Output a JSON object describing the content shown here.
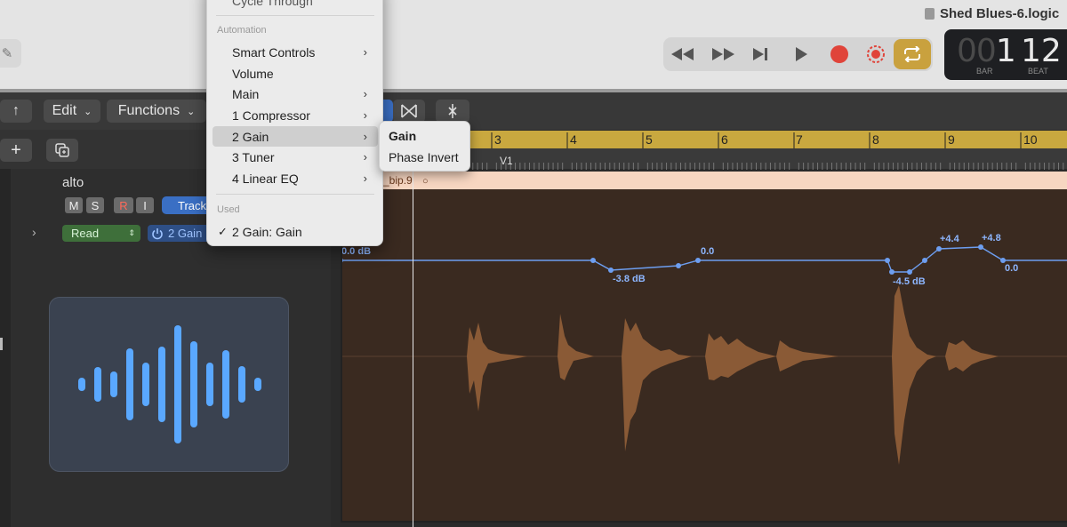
{
  "window": {
    "document_title": "Shed Blues-6.logic"
  },
  "lcd": {
    "bar_dim": "00",
    "bar_value": "1",
    "beat_value": "12",
    "bar_label": "BAR",
    "beat_label": "BEAT"
  },
  "toolbar": {
    "edit_label": "Edit",
    "functions_label": "Functions"
  },
  "ruler": {
    "bars": [
      "3",
      "4",
      "5",
      "6",
      "7",
      "8",
      "9",
      "10"
    ],
    "marker": "V1"
  },
  "track": {
    "name": "alto",
    "mute": "M",
    "solo": "S",
    "record": "R",
    "input": "I",
    "track_button": "Track",
    "automation_mode": "Read",
    "automation_param": "2 Gain"
  },
  "region": {
    "name": "_bip.9"
  },
  "automation_labels": [
    "0.0 dB",
    "-3.8 dB",
    "0.0",
    "-4.5 dB",
    "+4.4",
    "+4.8",
    "0.0"
  ],
  "menu": {
    "cut_off_item": "Cycle Through",
    "automation_header": "Automation",
    "items": [
      {
        "label": "Smart Controls",
        "submenu": true
      },
      {
        "label": "Volume",
        "submenu": false
      },
      {
        "label": "Main",
        "submenu": true
      },
      {
        "label": "1 Compressor",
        "submenu": true
      },
      {
        "label": "2 Gain",
        "submenu": true
      },
      {
        "label": "3 Tuner",
        "submenu": true
      },
      {
        "label": "4 Linear EQ",
        "submenu": true
      }
    ],
    "used_header": "Used",
    "used_items": [
      {
        "label": "2 Gain: Gain",
        "checked": true
      }
    ]
  },
  "submenu": {
    "items": [
      "Gain",
      "Phase Invert"
    ]
  },
  "colors": {
    "accent_cycle": "#c9a13e",
    "record_red": "#e0443a",
    "automation_line": "#6d9ef0",
    "waveform": "#8a5a36",
    "ruler": "#c9a83f"
  }
}
